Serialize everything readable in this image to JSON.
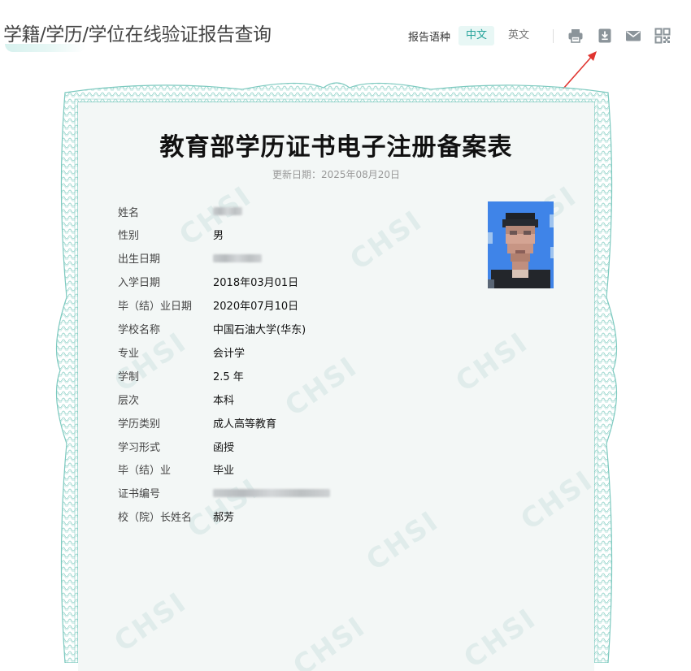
{
  "header": {
    "title": "学籍/学历/学位在线验证报告查询",
    "lang_label": "报告语种",
    "lang_options": [
      "中文",
      "英文"
    ],
    "active_lang": "中文"
  },
  "toolbar": {
    "icons": [
      "print-icon",
      "download-icon",
      "mail-icon",
      "qrcode-icon"
    ]
  },
  "certificate": {
    "title": "教育部学历证书电子注册备案表",
    "update_date": "更新日期：2025年08月20日",
    "watermark_text": "CHSI",
    "fields": [
      {
        "label": "姓名",
        "value": "",
        "redacted": true
      },
      {
        "label": "性别",
        "value": "男",
        "redacted": false
      },
      {
        "label": "出生日期",
        "value": "",
        "redacted": true
      },
      {
        "label": "入学日期",
        "value": "2018年03月01日",
        "redacted": false
      },
      {
        "label": "毕（结）业日期",
        "value": "2020年07月10日",
        "redacted": false
      },
      {
        "label": "学校名称",
        "value": "中国石油大学(华东)",
        "redacted": false
      },
      {
        "label": "专业",
        "value": "会计学",
        "redacted": false
      },
      {
        "label": "学制",
        "value": "2.5 年",
        "redacted": false
      },
      {
        "label": "层次",
        "value": "本科",
        "redacted": false
      },
      {
        "label": "学历类别",
        "value": "成人高等教育",
        "redacted": false
      },
      {
        "label": "学习形式",
        "value": "函授",
        "redacted": false
      },
      {
        "label": "毕（结）业",
        "value": "毕业",
        "redacted": false
      },
      {
        "label": "证书编号",
        "value": "",
        "redacted": true
      },
      {
        "label": "校（院）长姓名",
        "value": "郝芳",
        "redacted": false
      }
    ]
  },
  "colors": {
    "accent": "#24a39a",
    "accent_bg": "#e8f7f5",
    "border_green": "#7cc9bf",
    "photo_bg": "#3f84e8",
    "arrow": "#e0342f"
  }
}
